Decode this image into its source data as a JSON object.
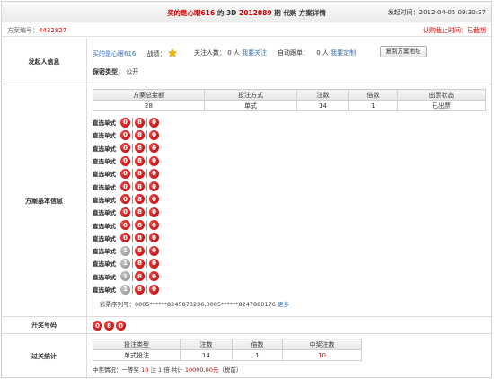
{
  "header": {
    "title_user": "买的是心眼616",
    "title_of": "的",
    "title_lottery": "3D",
    "title_issue": "2012089",
    "title_rest": "期 代购 方案详情",
    "publish_label": "发起时间：",
    "publish_time": "2012-04-05 09:30:37"
  },
  "subbar": {
    "plan_label": "方案编号：",
    "plan_no": "4432827",
    "deadline_text": "认购截止时间：已截期"
  },
  "sections": {
    "initiator": "发起人信息",
    "basic": "方案基本信息",
    "winning": "开奖号码",
    "stats": "过关统计"
  },
  "initiator": {
    "username": "买的是心眼616",
    "record_label": "战绩：",
    "follow_label": "关注人数：",
    "follow_count": "0 人",
    "follow_link": "我要关注",
    "auto_label": "自动跟单：",
    "auto_count": "0 人",
    "auto_link": "我要定制",
    "copy_button": "复制方案地址",
    "privacy_label": "保密类型：",
    "privacy_value": "公开"
  },
  "plan_table": {
    "headers": [
      "方案总金额",
      "投注方式",
      "注数",
      "倍数",
      "出票状态"
    ],
    "row": [
      "28",
      "单式",
      "14",
      "1",
      "已出票"
    ]
  },
  "bets": {
    "label": "直选单式",
    "rows": [
      [
        {
          "n": "0",
          "c": "red"
        },
        {
          "n": "8",
          "c": "red"
        },
        {
          "n": "0",
          "c": "red"
        }
      ],
      [
        {
          "n": "0",
          "c": "red"
        },
        {
          "n": "8",
          "c": "red"
        },
        {
          "n": "0",
          "c": "red"
        }
      ],
      [
        {
          "n": "0",
          "c": "red"
        },
        {
          "n": "8",
          "c": "red"
        },
        {
          "n": "0",
          "c": "red"
        }
      ],
      [
        {
          "n": "0",
          "c": "red"
        },
        {
          "n": "8",
          "c": "red"
        },
        {
          "n": "0",
          "c": "red"
        }
      ],
      [
        {
          "n": "0",
          "c": "red"
        },
        {
          "n": "8",
          "c": "red"
        },
        {
          "n": "0",
          "c": "red"
        }
      ],
      [
        {
          "n": "0",
          "c": "red"
        },
        {
          "n": "8",
          "c": "red"
        },
        {
          "n": "0",
          "c": "red"
        }
      ],
      [
        {
          "n": "0",
          "c": "red"
        },
        {
          "n": "8",
          "c": "red"
        },
        {
          "n": "0",
          "c": "red"
        }
      ],
      [
        {
          "n": "0",
          "c": "red"
        },
        {
          "n": "8",
          "c": "red"
        },
        {
          "n": "0",
          "c": "red"
        }
      ],
      [
        {
          "n": "0",
          "c": "red"
        },
        {
          "n": "8",
          "c": "red"
        },
        {
          "n": "0",
          "c": "red"
        }
      ],
      [
        {
          "n": "0",
          "c": "red"
        },
        {
          "n": "8",
          "c": "red"
        },
        {
          "n": "0",
          "c": "red"
        }
      ],
      [
        {
          "n": "1",
          "c": "grey"
        },
        {
          "n": "8",
          "c": "red"
        },
        {
          "n": "0",
          "c": "red"
        }
      ],
      [
        {
          "n": "1",
          "c": "grey"
        },
        {
          "n": "8",
          "c": "red"
        },
        {
          "n": "0",
          "c": "red"
        }
      ],
      [
        {
          "n": "1",
          "c": "grey"
        },
        {
          "n": "8",
          "c": "red"
        },
        {
          "n": "0",
          "c": "red"
        }
      ],
      [
        {
          "n": "1",
          "c": "grey"
        },
        {
          "n": "8",
          "c": "red"
        },
        {
          "n": "0",
          "c": "red"
        }
      ]
    ]
  },
  "serial": {
    "label": "彩票序列号：",
    "value": "0005******8245873236,0005******8247880176",
    "more_link": "更多"
  },
  "winning_numbers": [
    "0",
    "8",
    "0"
  ],
  "stats_table": {
    "headers": [
      "投注类型",
      "注数",
      "倍数",
      "中奖注数"
    ],
    "row": [
      "单式投注",
      "14",
      "1",
      "10"
    ]
  },
  "prize": {
    "prefix": "中奖情况：一等奖",
    "count": "10",
    "unit": "注 1 倍 共计",
    "amount": "10000.00元",
    "suffix": "（税前）"
  },
  "colors": {
    "accent_red": "#cc0000",
    "link_blue": "#3a6fb0",
    "ball_red": "#d00000",
    "ball_grey": "#999999"
  }
}
